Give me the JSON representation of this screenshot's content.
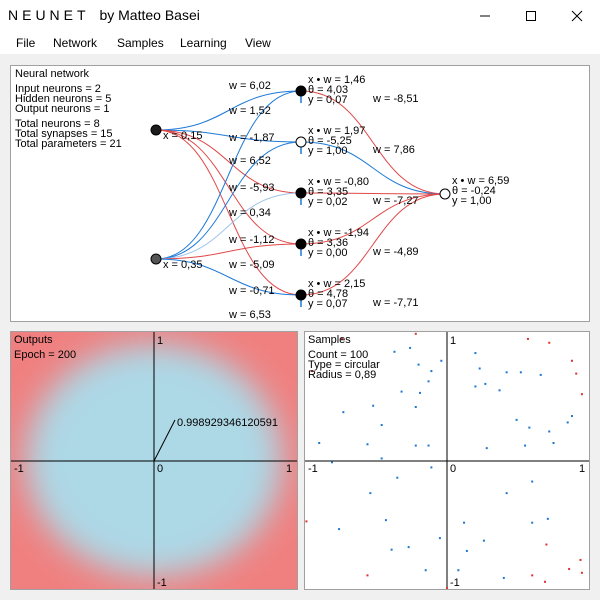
{
  "window": {
    "app_name": "NEUNET",
    "byline": "by Matteo Basei"
  },
  "menu": [
    "File",
    "Network",
    "Samples",
    "Learning",
    "View"
  ],
  "network": {
    "title": "Neural network",
    "stats": [
      "Input neurons = 2",
      "Hidden neurons = 5",
      "Output neurons = 1",
      "Total neurons = 8",
      "Total synapses = 15",
      "Total parameters = 21"
    ],
    "inputs": [
      {
        "label": "x = 0,15",
        "color": "#1c1c1c"
      },
      {
        "label": "x = 0,35",
        "color": "#555555"
      }
    ],
    "hidden": [
      {
        "xw": "x • w = 1,46",
        "theta": "θ = 4,03",
        "y": "y = 0,07",
        "w_out": "w = -8,51",
        "fill": "#000000",
        "w_in": [
          "w = 6,02",
          "w = 1,52"
        ]
      },
      {
        "xw": "x • w = 1,97",
        "theta": "θ = -5,25",
        "y": "y = 1,00",
        "w_out": "w = 7,86",
        "fill": "#ffffff",
        "w_in": [
          "w = -1,87",
          "w = 6,52"
        ]
      },
      {
        "xw": "x • w = -0,80",
        "theta": "θ = 3,35",
        "y": "y = 0,02",
        "w_out": "w = -7,27",
        "fill": "#000000",
        "w_in": [
          "w = -5,93",
          "w = 0,34"
        ]
      },
      {
        "xw": "x • w = -1,94",
        "theta": "θ = 3,36",
        "y": "y = 0,00",
        "w_out": "w = -4,89",
        "fill": "#000000",
        "w_in": [
          "w = -1,12",
          "w = -5,09"
        ]
      },
      {
        "xw": "x • w = 2,15",
        "theta": "θ = 4,78",
        "y": "y = 0,07",
        "w_out": "w = -7,71",
        "fill": "#000000",
        "w_in": [
          "w = -0,71",
          "w = 6,53"
        ]
      }
    ],
    "output": {
      "xw": "x • w = 6,59",
      "theta": "θ = -0,24",
      "y": "y = 1,00",
      "fill": "#ffffff"
    }
  },
  "outputs_panel": {
    "title": "Outputs",
    "epoch": "Epoch = 200",
    "axis": {
      "top": "1",
      "bottom": "-1",
      "left": "-1",
      "right": "1",
      "origin": "0"
    },
    "probe_value": "0.998929346120591",
    "colors": {
      "inside": "#add8e6",
      "outside": "#f08080"
    }
  },
  "samples_panel": {
    "title": "Samples",
    "count": "Count = 100",
    "type": "Type = circular",
    "radius": "Radius = 0,89",
    "axis": {
      "top": "1",
      "bottom": "-1",
      "left": "-1",
      "right": "1",
      "origin": "0"
    },
    "colors": {
      "blue": "#1f77d0",
      "red": "#e03030"
    }
  },
  "chart_data": {
    "type": "scatter",
    "title": "Samples",
    "xlim": [
      -1,
      1
    ],
    "ylim": [
      -1,
      1
    ],
    "series": [
      {
        "name": "",
        "color": "#1f77d0",
        "points": [
          [
            -0.37,
            0.85
          ],
          [
            -0.26,
            0.88
          ],
          [
            -0.2,
            0.75
          ],
          [
            -0.04,
            0.78
          ],
          [
            -0.11,
            0.7
          ],
          [
            -0.13,
            0.62
          ],
          [
            -0.19,
            0.53
          ],
          [
            -0.32,
            0.54
          ],
          [
            0.2,
            0.84
          ],
          [
            0.27,
            0.6
          ],
          [
            0.23,
            0.72
          ],
          [
            0.42,
            0.69
          ],
          [
            0.37,
            0.55
          ],
          [
            0.2,
            0.58
          ],
          [
            0.52,
            0.69
          ],
          [
            0.66,
            0.67
          ],
          [
            -0.73,
            0.38
          ],
          [
            -0.52,
            0.43
          ],
          [
            -0.46,
            0.28
          ],
          [
            -0.22,
            0.42
          ],
          [
            0.49,
            0.32
          ],
          [
            0.58,
            0.26
          ],
          [
            0.72,
            0.23
          ],
          [
            0.85,
            0.3
          ],
          [
            0.88,
            0.35
          ],
          [
            -0.9,
            0.14
          ],
          [
            -0.56,
            0.13
          ],
          [
            -0.22,
            0.12
          ],
          [
            -0.13,
            0.12
          ],
          [
            0.28,
            0.1
          ],
          [
            0.55,
            0.12
          ],
          [
            0.75,
            0.14
          ],
          [
            -0.46,
            0.02
          ],
          [
            -0.35,
            -0.13
          ],
          [
            -0.54,
            -0.25
          ],
          [
            -0.81,
            -0.01
          ],
          [
            -0.11,
            -0.05
          ],
          [
            0.42,
            -0.25
          ],
          [
            0.6,
            -0.16
          ],
          [
            -0.43,
            -0.46
          ],
          [
            -0.76,
            -0.53
          ],
          [
            -0.39,
            -0.69
          ],
          [
            -0.27,
            -0.67
          ],
          [
            -0.05,
            -0.6
          ],
          [
            0.12,
            -0.48
          ],
          [
            0.26,
            -0.62
          ],
          [
            0.6,
            -0.48
          ],
          [
            0.71,
            -0.45
          ],
          [
            -0.15,
            -0.85
          ],
          [
            0.08,
            -0.85
          ],
          [
            0.14,
            -0.7
          ],
          [
            0.4,
            -0.91
          ]
        ]
      },
      {
        "name": "",
        "color": "#e03030",
        "points": [
          [
            -0.74,
            0.95
          ],
          [
            -0.22,
            0.99
          ],
          [
            0.57,
            0.95
          ],
          [
            0.72,
            0.92
          ],
          [
            0.88,
            0.78
          ],
          [
            0.91,
            0.68
          ],
          [
            0.95,
            0.52
          ],
          [
            -0.99,
            -0.47
          ],
          [
            0.86,
            -0.84
          ],
          [
            0.94,
            -0.77
          ],
          [
            0.95,
            -0.87
          ],
          [
            0.69,
            -0.94
          ],
          [
            0.6,
            -0.89
          ],
          [
            -0.56,
            -0.89
          ],
          [
            0.0,
            -0.99
          ],
          [
            0.7,
            -0.65
          ],
          [
            -0.95,
            0.7
          ]
        ]
      }
    ]
  }
}
